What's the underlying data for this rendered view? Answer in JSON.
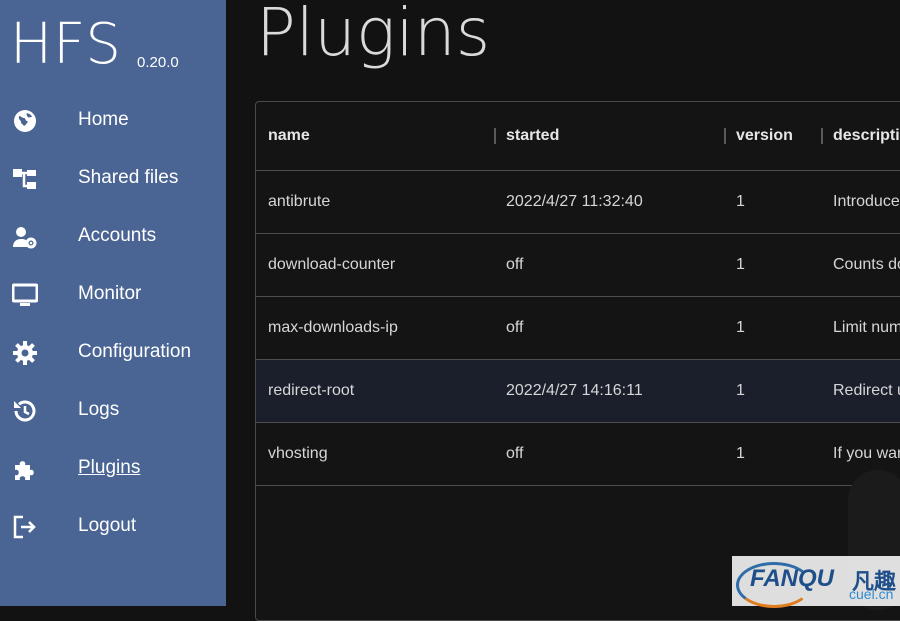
{
  "app": {
    "name": "HFS",
    "version": "0.20.0"
  },
  "nav": [
    {
      "label": "Home",
      "icon": "globe-icon"
    },
    {
      "label": "Shared files",
      "icon": "sitemap-icon"
    },
    {
      "label": "Accounts",
      "icon": "user-cog-icon"
    },
    {
      "label": "Monitor",
      "icon": "monitor-icon"
    },
    {
      "label": "Configuration",
      "icon": "gear-icon"
    },
    {
      "label": "Logs",
      "icon": "history-icon"
    },
    {
      "label": "Plugins",
      "icon": "puzzle-icon",
      "active": true
    },
    {
      "label": "Logout",
      "icon": "logout-icon"
    }
  ],
  "page": {
    "title": "Plugins"
  },
  "table": {
    "columns": [
      "name",
      "started",
      "version",
      "description"
    ],
    "rows": [
      {
        "name": "antibrute",
        "started": "2022/4/27 11:32:40",
        "version": "1",
        "description": "Introduce incr"
      },
      {
        "name": "download-counter",
        "started": "off",
        "version": "1",
        "description": "Counts downl"
      },
      {
        "name": "max-downloads-ip",
        "started": "off",
        "version": "1",
        "description": "Limit number"
      },
      {
        "name": "redirect-root",
        "started": "2022/4/27 14:16:11",
        "version": "1",
        "description": "Redirect users"
      },
      {
        "name": "vhosting",
        "started": "off",
        "version": "1",
        "description": "If you want to"
      }
    ]
  },
  "watermark": {
    "brand": "FANQU",
    "cn": "凡趣",
    "domain": "cuel.cn"
  },
  "colors": {
    "sidebar": "#4a6593",
    "background": "#121212",
    "highlight_row": "#1a1f2b"
  }
}
